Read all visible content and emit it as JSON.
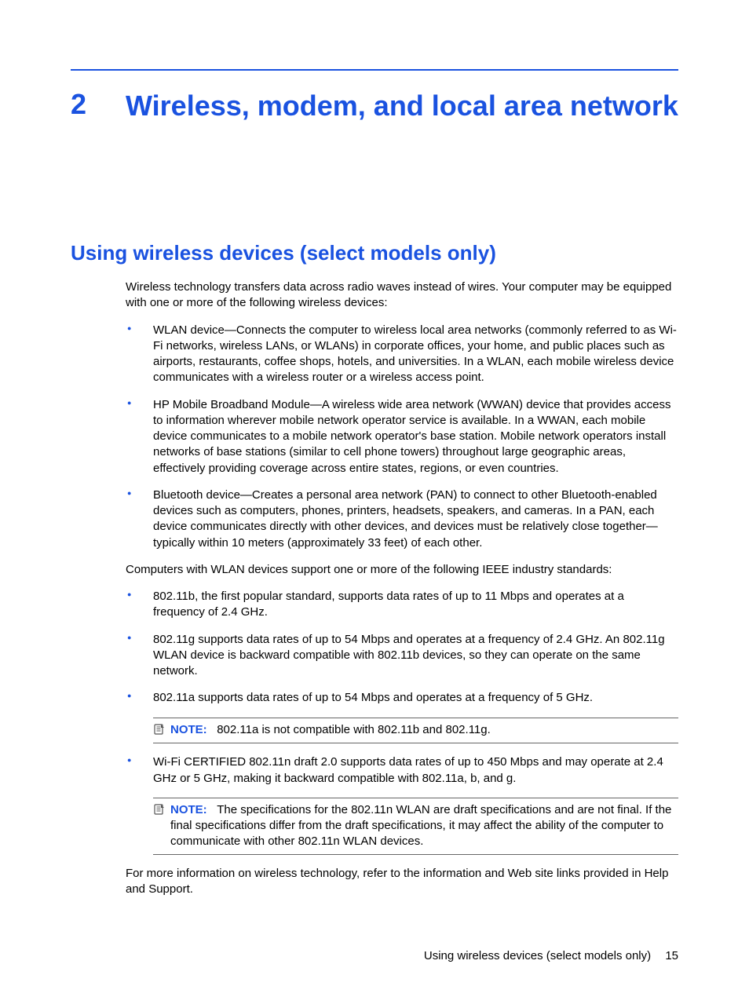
{
  "chapter": {
    "number": "2",
    "title": "Wireless, modem, and local area network"
  },
  "section": {
    "heading": "Using wireless devices (select models only)",
    "intro": "Wireless technology transfers data across radio waves instead of wires. Your computer may be equipped with one or more of the following wireless devices:",
    "devices": [
      "WLAN device—Connects the computer to wireless local area networks (commonly referred to as Wi-Fi networks, wireless LANs, or WLANs) in corporate offices, your home, and public places such as airports, restaurants, coffee shops, hotels, and universities. In a WLAN, each mobile wireless device communicates with a wireless router or a wireless access point.",
      "HP Mobile Broadband Module—A wireless wide area network (WWAN) device that provides access to information wherever mobile network operator service is available. In a WWAN, each mobile device communicates to a mobile network operator's base station. Mobile network operators install networks of base stations (similar to cell phone towers) throughout large geographic areas, effectively providing coverage across entire states, regions, or even countries.",
      "Bluetooth device—Creates a personal area network (PAN) to connect to other Bluetooth-enabled devices such as computers, phones, printers, headsets, speakers, and cameras. In a PAN, each device communicates directly with other devices, and devices must be relatively close together—typically within 10 meters (approximately 33 feet) of each other."
    ],
    "standards_intro": "Computers with WLAN devices support one or more of the following IEEE industry standards:",
    "standards_a": [
      "802.11b, the first popular standard, supports data rates of up to 11 Mbps and operates at a frequency of 2.4 GHz.",
      "802.11g supports data rates of up to 54 Mbps and operates at a frequency of 2.4 GHz. An 802.11g WLAN device is backward compatible with 802.11b devices, so they can operate on the same network.",
      "802.11a supports data rates of up to 54 Mbps and operates at a frequency of 5 GHz."
    ],
    "note1_label": "NOTE:",
    "note1_text": "802.11a is not compatible with 802.11b and 802.11g.",
    "standards_b": [
      "Wi-Fi CERTIFIED 802.11n draft 2.0 supports data rates of up to 450 Mbps and may operate at 2.4 GHz or 5 GHz, making it backward compatible with 802.11a, b, and g."
    ],
    "note2_label": "NOTE:",
    "note2_text": "The specifications for the 802.11n WLAN are draft specifications and are not final. If the final specifications differ from the draft specifications, it may affect the ability of the computer to communicate with other 802.11n WLAN devices.",
    "closing": "For more information on wireless technology, refer to the information and Web site links provided in Help and Support."
  },
  "footer": {
    "text": "Using wireless devices (select models only)",
    "page": "15"
  }
}
